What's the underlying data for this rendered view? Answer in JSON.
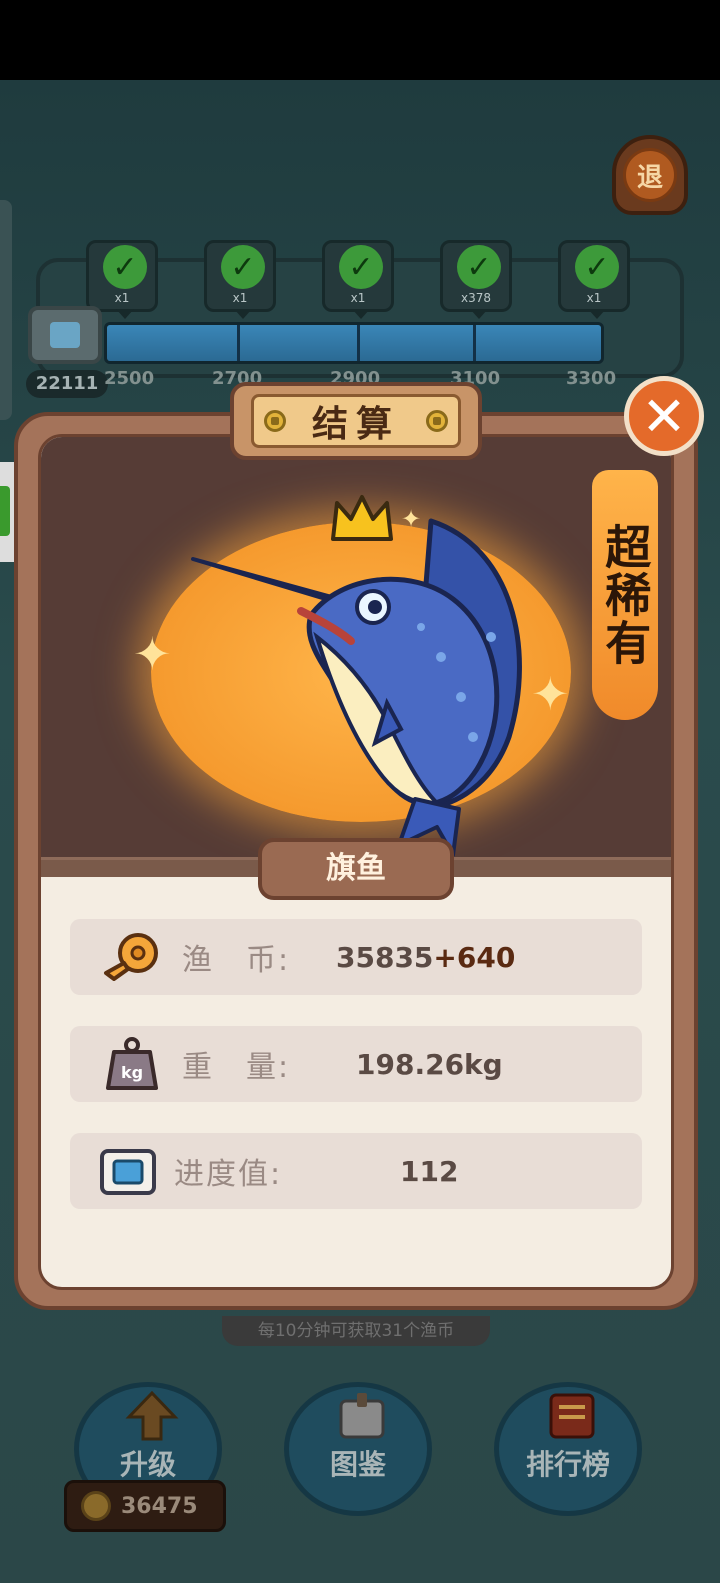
{
  "exit_button": {
    "label": "退"
  },
  "progress": {
    "current": "22111",
    "milestones": [
      {
        "count": "x1"
      },
      {
        "count": "x1"
      },
      {
        "count": "x1"
      },
      {
        "count": "x378"
      },
      {
        "count": "x1"
      }
    ],
    "ticks": [
      "2500",
      "2700",
      "2900",
      "3100",
      "3300"
    ],
    "fill_fraction": 1.0
  },
  "modal": {
    "title": "结算",
    "rarity": "超稀有",
    "fish_name": "旗鱼",
    "stats": {
      "coins": {
        "label": "渔　币:",
        "base": "35835",
        "bonus": "+640"
      },
      "weight": {
        "label": "重　量:",
        "value": "198.26kg"
      },
      "progress": {
        "label": "进度值:",
        "value": "112"
      }
    }
  },
  "hint": "每10分钟可获取31个渔币",
  "bottom_buttons": [
    {
      "label": "升级"
    },
    {
      "label": "图鉴"
    },
    {
      "label": "排行榜"
    }
  ],
  "coin_balance": "36475",
  "icons": {
    "exit": "exit-icon",
    "close": "close-icon",
    "crown": "crown-icon",
    "coin": "fish-coin-icon",
    "weight": "kg-weight-icon",
    "ticket": "progress-ticket-icon"
  },
  "colors": {
    "accent_orange": "#e46a2a",
    "rarity_orange": "#f59a2e",
    "panel_brown": "#a4735a"
  }
}
